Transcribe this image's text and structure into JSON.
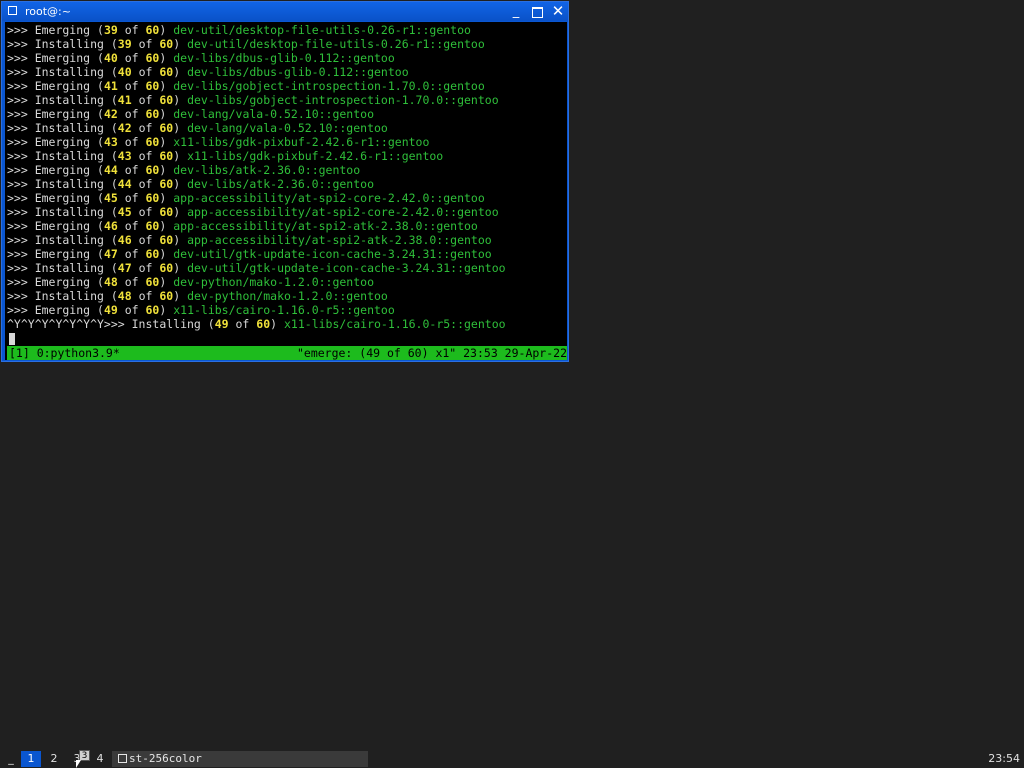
{
  "window": {
    "title": "root@:~",
    "minimize_label": "_",
    "close_label": "✕"
  },
  "terminal": {
    "lines": [
      {
        "prefix": ">>> Emerging (",
        "n": "39",
        "of": " of ",
        "total": "60",
        "close": ") ",
        "pkg": "dev-util/desktop-file-utils-0.26-r1::gentoo"
      },
      {
        "prefix": ">>> Installing (",
        "n": "39",
        "of": " of ",
        "total": "60",
        "close": ") ",
        "pkg": "dev-util/desktop-file-utils-0.26-r1::gentoo"
      },
      {
        "prefix": ">>> Emerging (",
        "n": "40",
        "of": " of ",
        "total": "60",
        "close": ") ",
        "pkg": "dev-libs/dbus-glib-0.112::gentoo"
      },
      {
        "prefix": ">>> Installing (",
        "n": "40",
        "of": " of ",
        "total": "60",
        "close": ") ",
        "pkg": "dev-libs/dbus-glib-0.112::gentoo"
      },
      {
        "prefix": ">>> Emerging (",
        "n": "41",
        "of": " of ",
        "total": "60",
        "close": ") ",
        "pkg": "dev-libs/gobject-introspection-1.70.0::gentoo"
      },
      {
        "prefix": ">>> Installing (",
        "n": "41",
        "of": " of ",
        "total": "60",
        "close": ") ",
        "pkg": "dev-libs/gobject-introspection-1.70.0::gentoo"
      },
      {
        "prefix": ">>> Emerging (",
        "n": "42",
        "of": " of ",
        "total": "60",
        "close": ") ",
        "pkg": "dev-lang/vala-0.52.10::gentoo"
      },
      {
        "prefix": ">>> Installing (",
        "n": "42",
        "of": " of ",
        "total": "60",
        "close": ") ",
        "pkg": "dev-lang/vala-0.52.10::gentoo"
      },
      {
        "prefix": ">>> Emerging (",
        "n": "43",
        "of": " of ",
        "total": "60",
        "close": ") ",
        "pkg": "x11-libs/gdk-pixbuf-2.42.6-r1::gentoo"
      },
      {
        "prefix": ">>> Installing (",
        "n": "43",
        "of": " of ",
        "total": "60",
        "close": ") ",
        "pkg": "x11-libs/gdk-pixbuf-2.42.6-r1::gentoo"
      },
      {
        "prefix": ">>> Emerging (",
        "n": "44",
        "of": " of ",
        "total": "60",
        "close": ") ",
        "pkg": "dev-libs/atk-2.36.0::gentoo"
      },
      {
        "prefix": ">>> Installing (",
        "n": "44",
        "of": " of ",
        "total": "60",
        "close": ") ",
        "pkg": "dev-libs/atk-2.36.0::gentoo"
      },
      {
        "prefix": ">>> Emerging (",
        "n": "45",
        "of": " of ",
        "total": "60",
        "close": ") ",
        "pkg": "app-accessibility/at-spi2-core-2.42.0::gentoo"
      },
      {
        "prefix": ">>> Installing (",
        "n": "45",
        "of": " of ",
        "total": "60",
        "close": ") ",
        "pkg": "app-accessibility/at-spi2-core-2.42.0::gentoo"
      },
      {
        "prefix": ">>> Emerging (",
        "n": "46",
        "of": " of ",
        "total": "60",
        "close": ") ",
        "pkg": "app-accessibility/at-spi2-atk-2.38.0::gentoo"
      },
      {
        "prefix": ">>> Installing (",
        "n": "46",
        "of": " of ",
        "total": "60",
        "close": ") ",
        "pkg": "app-accessibility/at-spi2-atk-2.38.0::gentoo"
      },
      {
        "prefix": ">>> Emerging (",
        "n": "47",
        "of": " of ",
        "total": "60",
        "close": ") ",
        "pkg": "dev-util/gtk-update-icon-cache-3.24.31::gentoo"
      },
      {
        "prefix": ">>> Installing (",
        "n": "47",
        "of": " of ",
        "total": "60",
        "close": ") ",
        "pkg": "dev-util/gtk-update-icon-cache-3.24.31::gentoo"
      },
      {
        "prefix": ">>> Emerging (",
        "n": "48",
        "of": " of ",
        "total": "60",
        "close": ") ",
        "pkg": "dev-python/mako-1.2.0::gentoo"
      },
      {
        "prefix": ">>> Installing (",
        "n": "48",
        "of": " of ",
        "total": "60",
        "close": ") ",
        "pkg": "dev-python/mako-1.2.0::gentoo"
      },
      {
        "prefix": ">>> Emerging (",
        "n": "49",
        "of": " of ",
        "total": "60",
        "close": ") ",
        "pkg": "x11-libs/cairo-1.16.0-r5::gentoo"
      },
      {
        "prefix": "^Y^Y^Y^Y^Y^Y^Y>>> Installing (",
        "n": "49",
        "of": " of ",
        "total": "60",
        "close": ") ",
        "pkg": "x11-libs/cairo-1.16.0-r5::gentoo"
      }
    ],
    "status_left": "[1] 0:python3.9*",
    "status_right": "\"emerge: (49 of 60) x1\" 23:53 29-Apr-22"
  },
  "taskbar": {
    "underscore": "_",
    "workspaces": [
      "1",
      "2",
      "3",
      "4"
    ],
    "ws3_badge": "3",
    "task_label": "st-256color",
    "clock": "23:54"
  },
  "colors": {
    "titlebar": "#0a56d0",
    "status_bar": "#1dbb1d",
    "package_text": "#2fbf3a",
    "number_text": "#f0e13a"
  }
}
